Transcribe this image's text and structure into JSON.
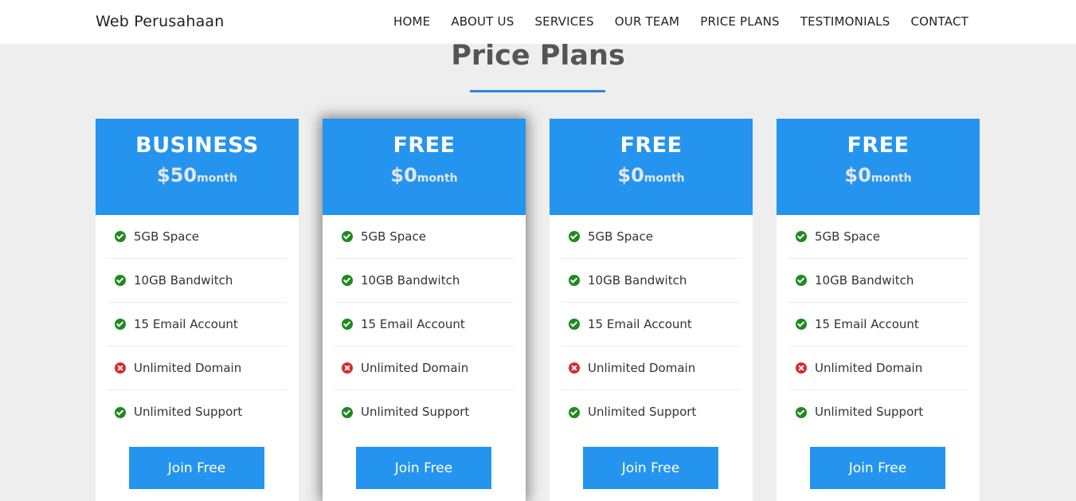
{
  "brand": "Web Perusahaan",
  "nav": [
    "HOME",
    "ABOUT US",
    "SERVICES",
    "OUR TEAM",
    "PRICE PLANS",
    "TESTIMONIALS",
    "CONTACT"
  ],
  "section_title": "Price Plans",
  "colors": {
    "accent": "#2594ef",
    "check": "#1e8a1e",
    "cross": "#d62c2c",
    "background": "#eeeeee"
  },
  "plans": [
    {
      "name": "BUSINESS",
      "price": "$50",
      "period": "month",
      "button": "Join Free",
      "features": [
        {
          "text": "5GB Space",
          "icon": "check-icon"
        },
        {
          "text": "10GB Bandwitch",
          "icon": "check-icon"
        },
        {
          "text": "15 Email Account",
          "icon": "check-icon"
        },
        {
          "text": "Unlimited Domain",
          "icon": "cross-icon"
        },
        {
          "text": "Unlimited Support",
          "icon": "check-icon"
        }
      ]
    },
    {
      "name": "FREE",
      "price": "$0",
      "period": "month",
      "button": "Join Free",
      "features": [
        {
          "text": "5GB Space",
          "icon": "check-icon"
        },
        {
          "text": "10GB Bandwitch",
          "icon": "check-icon"
        },
        {
          "text": "15 Email Account",
          "icon": "check-icon"
        },
        {
          "text": "Unlimited Domain",
          "icon": "cross-icon"
        },
        {
          "text": "Unlimited Support",
          "icon": "check-icon"
        }
      ]
    },
    {
      "name": "FREE",
      "price": "$0",
      "period": "month",
      "button": "Join Free",
      "features": [
        {
          "text": "5GB Space",
          "icon": "check-icon"
        },
        {
          "text": "10GB Bandwitch",
          "icon": "check-icon"
        },
        {
          "text": "15 Email Account",
          "icon": "check-icon"
        },
        {
          "text": "Unlimited Domain",
          "icon": "cross-icon"
        },
        {
          "text": "Unlimited Support",
          "icon": "check-icon"
        }
      ]
    },
    {
      "name": "FREE",
      "price": "$0",
      "period": "month",
      "button": "Join Free",
      "features": [
        {
          "text": "5GB Space",
          "icon": "check-icon"
        },
        {
          "text": "10GB Bandwitch",
          "icon": "check-icon"
        },
        {
          "text": "15 Email Account",
          "icon": "check-icon"
        },
        {
          "text": "Unlimited Domain",
          "icon": "cross-icon"
        },
        {
          "text": "Unlimited Support",
          "icon": "check-icon"
        }
      ]
    }
  ]
}
